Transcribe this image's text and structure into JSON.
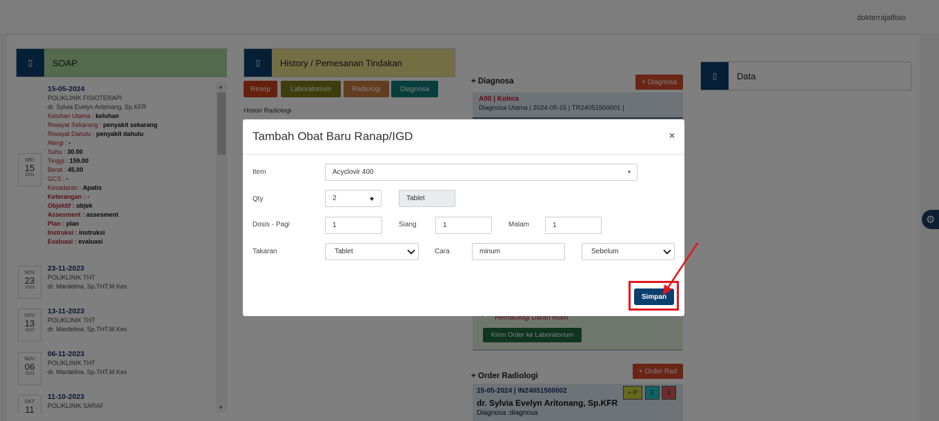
{
  "header": {
    "username": "dokterrajalfisio"
  },
  "soap": {
    "title": "SOAP",
    "icon": "square-icon",
    "entries": [
      {
        "month": "MEI",
        "day": "15",
        "year": "2024",
        "date": "15-05-2024",
        "poli": "POLIKLINIK FISIOTERAPI",
        "doctor": "dr. Sylvia Evelyn Aritonang, Sp.KFR",
        "fields": [
          {
            "k": "Keluhan Utama : ",
            "v": "keluhan"
          },
          {
            "k": "Riwayat Sekarang : ",
            "v": "penyakit sekarang"
          },
          {
            "k": "Riwayat Dahulu : ",
            "v": "penyakit dahulu"
          },
          {
            "k": "Alergi : ",
            "v": "-"
          },
          {
            "k": "Suhu : ",
            "v": "30.00"
          },
          {
            "k": "Tinggi : ",
            "v": "159.00"
          },
          {
            "k": "Berat : ",
            "v": "45.00"
          },
          {
            "k": "GCS : ",
            "v": "-"
          },
          {
            "k": "Kesadaran : ",
            "v": "Apatis"
          },
          {
            "k": "Keterangan : ",
            "v": "-"
          },
          {
            "k": "Objektif : ",
            "v": "objek"
          },
          {
            "k": "Assesment : ",
            "v": "assesment"
          },
          {
            "k": "Plan : ",
            "v": "plan"
          },
          {
            "k": "Instruksi : ",
            "v": "instruksi"
          },
          {
            "k": "Evaluasi : ",
            "v": "evaluasi"
          }
        ]
      },
      {
        "month": "NOV",
        "day": "23",
        "year": "2023",
        "date": "23-11-2023",
        "poli": "POLIKLINIK THT",
        "doctor": "dr. Mardelina, Sp.THT.M.Kes"
      },
      {
        "month": "NOV",
        "day": "13",
        "year": "2023",
        "date": "13-11-2023",
        "poli": "POLIKLINIK THT",
        "doctor": "dr. Mardelina, Sp.THT.M.Kes"
      },
      {
        "month": "NOV",
        "day": "06",
        "year": "2023",
        "date": "06-11-2023",
        "poli": "POLIKLINIK THT",
        "doctor": "dr. Mardelina, Sp.THT.M.Kes"
      },
      {
        "month": "OKT",
        "day": "11",
        "year": "",
        "date": "11-10-2023",
        "poli": "POLIKLINIK SARAF",
        "doctor": ""
      }
    ]
  },
  "history": {
    "title": "History / Pemesanan Tindakan",
    "buttons": [
      "Resep",
      "Laboratorium",
      "Radiologi",
      "Diagnosa"
    ],
    "section_label": "Histori Radiologi"
  },
  "diagnosa": {
    "title": "+ Diagnosa",
    "add_button": "+ Diagnosa",
    "card_title": "A00 | Kolera",
    "card_sub": "Diagnosa Utama | 2024-05-15 | TR24051500001 |"
  },
  "lab": {
    "bullet": "•",
    "item": "Hematologi Darah Rutin",
    "send_button": "Kirim Order ke Laboratorium"
  },
  "radiologi": {
    "title": "+ Order Radiologi",
    "add_button": "+ Order Rad",
    "card_line1": "15-05-2024 | IN24051500002",
    "card_line2": "dr. Sylvia Evelyn Aritonang, Sp.KFR",
    "card_line3": "Diagnosa :diagnosa",
    "mini_buttons": [
      "+ P",
      "E",
      "X"
    ]
  },
  "data_panel": {
    "title": "Data"
  },
  "modal": {
    "title": "Tambah Obat Baru Ranap/IGD",
    "close": "×",
    "item_label": "Item",
    "item_value": "Acyclovir 400",
    "qty_label": "Qty",
    "qty_value": "2",
    "unit_value": "Tablet",
    "dosis_label": "Dosis - Pagi",
    "pagi_value": "1",
    "siang_label": "Siang",
    "siang_value": "1",
    "malam_label": "Malam",
    "malam_value": "1",
    "takaran_label": "Takaran",
    "takaran_value": "Tablet",
    "cara_label": "Cara",
    "cara_value": "minum",
    "waktu_value": "Sebelum",
    "save_button": "Simpan"
  },
  "colors": {
    "primary": "#0b3f6e",
    "annotation_red": "#e4151f",
    "soap_header": "#a7d49b",
    "history_header": "#e8dc8a"
  }
}
